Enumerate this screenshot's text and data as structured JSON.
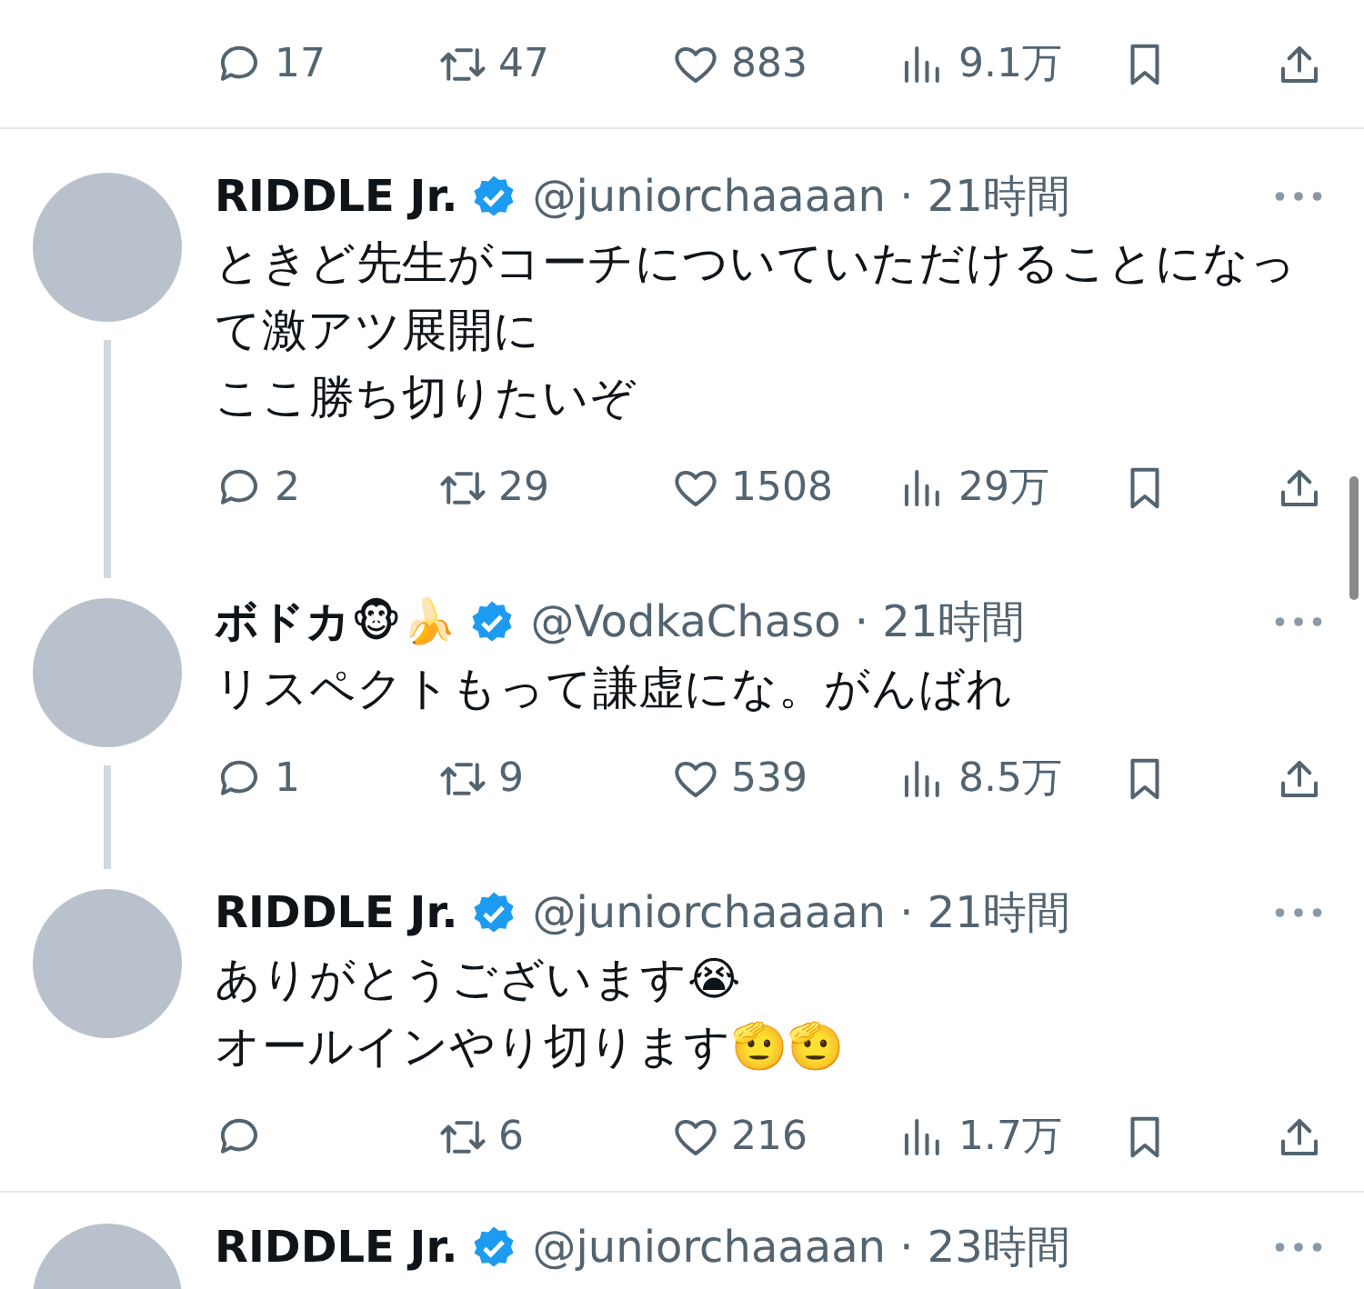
{
  "top_actions": {
    "replies": "17",
    "reposts": "47",
    "likes": "883",
    "views": "9.1万"
  },
  "tweets": [
    {
      "name": "RIDDLE Jr.",
      "verified": true,
      "meta": "@juniorchaaaan · 21時間",
      "lines": [
        "ときど先生がコーチについていただけることになっ",
        "て激アツ展開に",
        "ここ勝ち切りたいぞ"
      ],
      "actions": {
        "replies": "2",
        "reposts": "29",
        "likes": "1508",
        "views": "29万"
      },
      "thread_below": true
    },
    {
      "name": "ボドカ🐵🍌",
      "verified": true,
      "meta": "@VodkaChaso · 21時間",
      "lines": [
        "リスペクトもって謙虚にな。がんばれ"
      ],
      "actions": {
        "replies": "1",
        "reposts": "9",
        "likes": "539",
        "views": "8.5万"
      },
      "thread_below": true
    },
    {
      "name": "RIDDLE Jr.",
      "verified": true,
      "meta": "@juniorchaaaan · 21時間",
      "lines": [
        "ありがとうございます😭",
        "オールインやり切ります🫡🫡"
      ],
      "actions": {
        "reposts": "6",
        "likes": "216",
        "views": "1.7万"
      },
      "thread_below": false
    },
    {
      "name": "RIDDLE Jr.",
      "verified": true,
      "meta": "@juniorchaaaan · 23時間"
    }
  ]
}
